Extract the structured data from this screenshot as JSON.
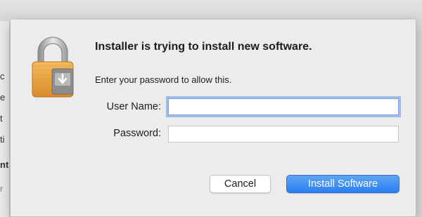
{
  "background_window": {
    "fragments": [
      "c",
      "e",
      "t",
      "ti",
      "nt",
      "r"
    ]
  },
  "dialog": {
    "icon": "padlock-installer-icon",
    "title": "Installer is trying to install new software.",
    "subtitle": "Enter your password to allow this.",
    "user_name": {
      "label": "User Name:",
      "value": "",
      "placeholder": ""
    },
    "password": {
      "label": "Password:",
      "value": "",
      "placeholder": ""
    },
    "buttons": {
      "cancel": "Cancel",
      "install": "Install Software"
    }
  },
  "colors": {
    "accent": "#2a7ff0",
    "focus_ring": "#6099e4",
    "lock_gold": "#e9a343",
    "dialog_bg": "#ececec"
  }
}
